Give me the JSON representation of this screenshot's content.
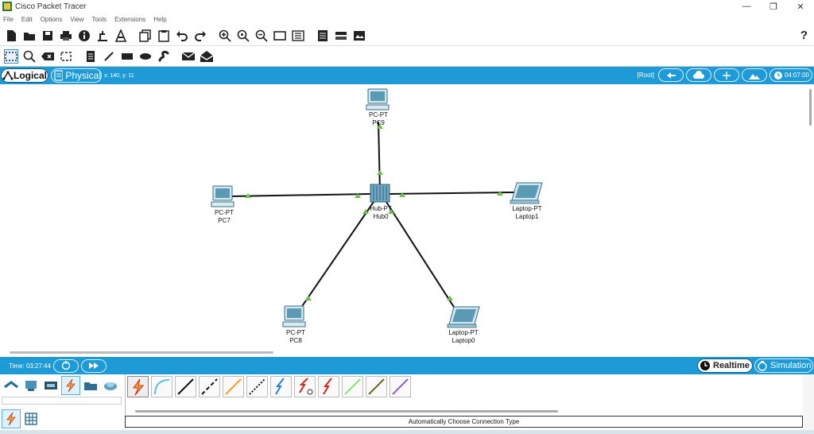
{
  "window": {
    "title": "Cisco Packet Tracer",
    "controls": [
      "—",
      "❐",
      "✕"
    ]
  },
  "menu": [
    "File",
    "Edit",
    "Options",
    "View",
    "Tools",
    "Extensions",
    "Help"
  ],
  "toolbar": {
    "help": "?"
  },
  "view": {
    "logical_label": "Logical",
    "physical_label": "Physical",
    "coords": "x: 140, y: 11",
    "root": "[Root]",
    "clock": "04:07:00"
  },
  "devices": [
    {
      "id": "pc9",
      "type": "PC-PT",
      "name": "PC9"
    },
    {
      "id": "pc7",
      "type": "PC-PT",
      "name": "PC7"
    },
    {
      "id": "hub0",
      "type": "Hub-PT",
      "name": "Hub0"
    },
    {
      "id": "laptop1",
      "type": "Laptop-PT",
      "name": "Laptop1"
    },
    {
      "id": "pc8",
      "type": "PC-PT",
      "name": "PC8"
    },
    {
      "id": "laptop0",
      "type": "Laptop-PT",
      "name": "Laptop0"
    }
  ],
  "status": {
    "time": "Time: 03:27:44",
    "realtime": "Realtime",
    "simulation": "Simulation"
  },
  "connection_hint": "Automatically Choose Connection Type",
  "colors": {
    "accent": "#1e9bd7",
    "link_indicator": "#6cc24a"
  }
}
